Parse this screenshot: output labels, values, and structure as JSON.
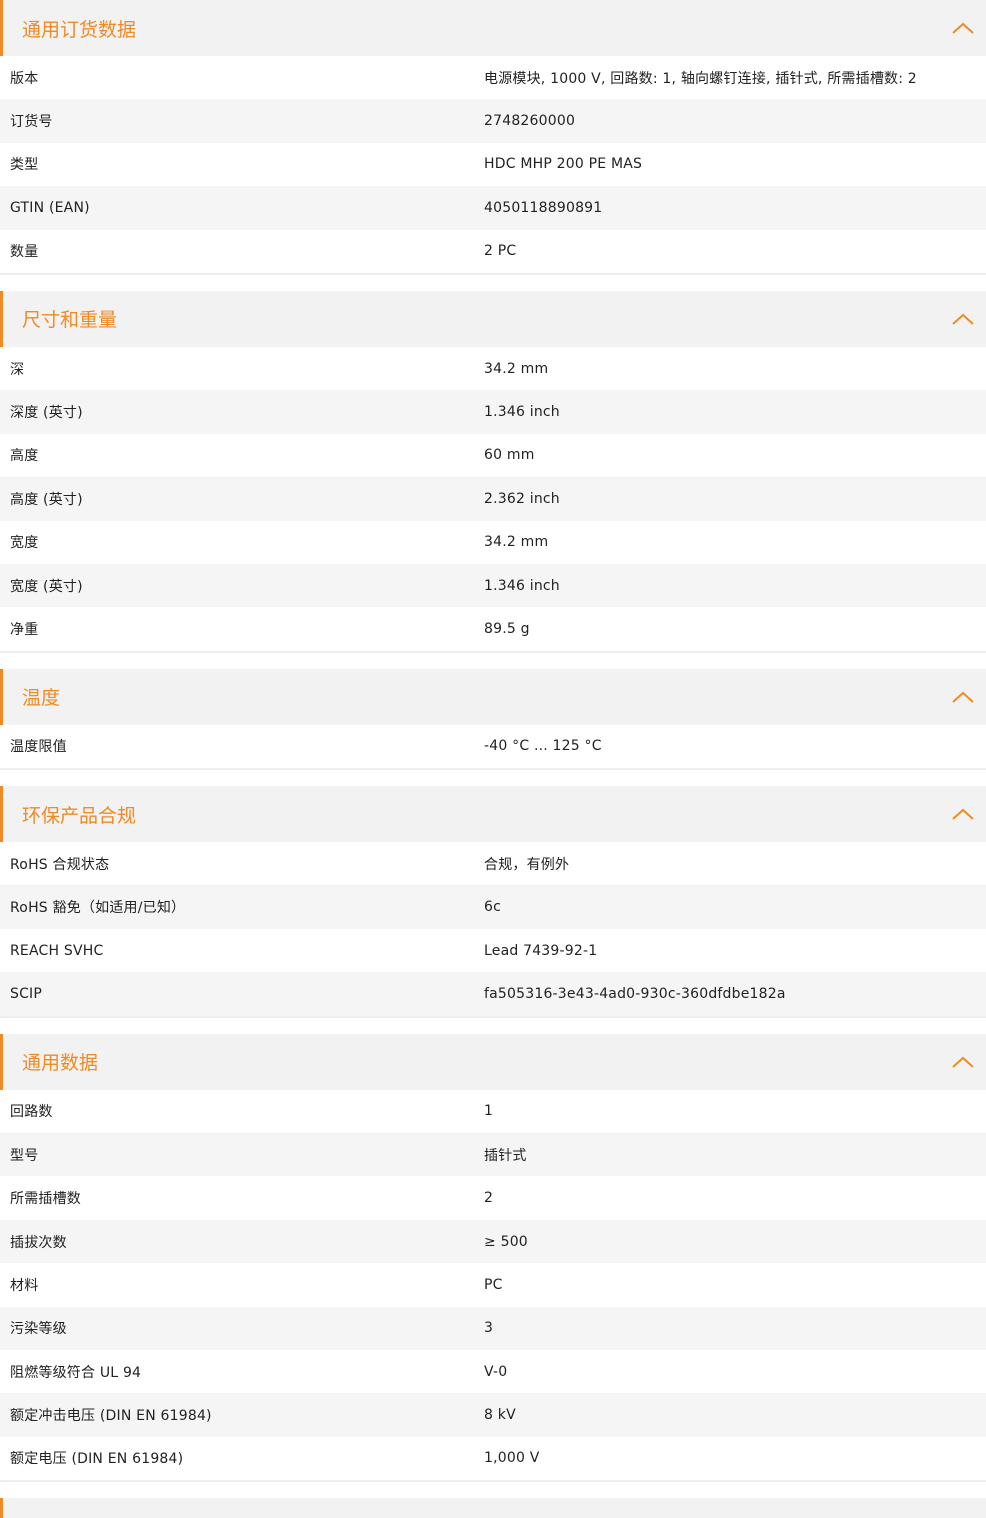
{
  "accent_color": "#f08a24",
  "header_icon": "chevron-up-icon",
  "sections": [
    {
      "title": "通用订货数据",
      "rows": [
        {
          "label": "版本",
          "value": "电源模块, 1000 V, 回路数: 1, 轴向螺钉连接, 插针式, 所需插槽数: 2"
        },
        {
          "label": "订货号",
          "value": "2748260000"
        },
        {
          "label": "类型",
          "value": "HDC MHP 200 PE MAS"
        },
        {
          "label": "GTIN (EAN)",
          "value": "4050118890891"
        },
        {
          "label": "数量",
          "value": "2  PC"
        }
      ]
    },
    {
      "title": "尺寸和重量",
      "rows": [
        {
          "label": "深",
          "value": "34.2  mm"
        },
        {
          "label": "深度 (英寸)",
          "value": "1.346  inch"
        },
        {
          "label": "高度",
          "value": "60  mm"
        },
        {
          "label": "高度 (英寸)",
          "value": "2.362  inch"
        },
        {
          "label": "宽度",
          "value": "34.2  mm"
        },
        {
          "label": "宽度 (英寸)",
          "value": "1.346  inch"
        },
        {
          "label": "净重",
          "value": "89.5  g"
        }
      ]
    },
    {
      "title": "温度",
      "rows": [
        {
          "label": "温度限值",
          "value": "-40 °C ... 125 °C"
        }
      ]
    },
    {
      "title": "环保产品合规",
      "rows": [
        {
          "label": "RoHS 合规状态",
          "value": "合规，有例外"
        },
        {
          "label": "RoHS 豁免（如适用/已知）",
          "value": "6c"
        },
        {
          "label": "REACH SVHC",
          "value": "Lead 7439-92-1"
        },
        {
          "label": "SCIP",
          "value": "fa505316-3e43-4ad0-930c-360dfdbe182a"
        }
      ]
    },
    {
      "title": "通用数据",
      "rows": [
        {
          "label": "回路数",
          "value": "1"
        },
        {
          "label": "型号",
          "value": "插针式"
        },
        {
          "label": "所需插槽数",
          "value": "2"
        },
        {
          "label": "插拔次数",
          "value": "≥ 500"
        },
        {
          "label": "材料",
          "value": "PC"
        },
        {
          "label": "污染等级",
          "value": "3"
        },
        {
          "label": "阻燃等级符合 UL 94",
          "value": "V-0"
        },
        {
          "label": "额定冲击电压 (DIN EN 61984)",
          "value": "8  kV"
        },
        {
          "label": "额定电压 (DIN EN 61984)",
          "value": "1,000  V"
        }
      ]
    }
  ]
}
